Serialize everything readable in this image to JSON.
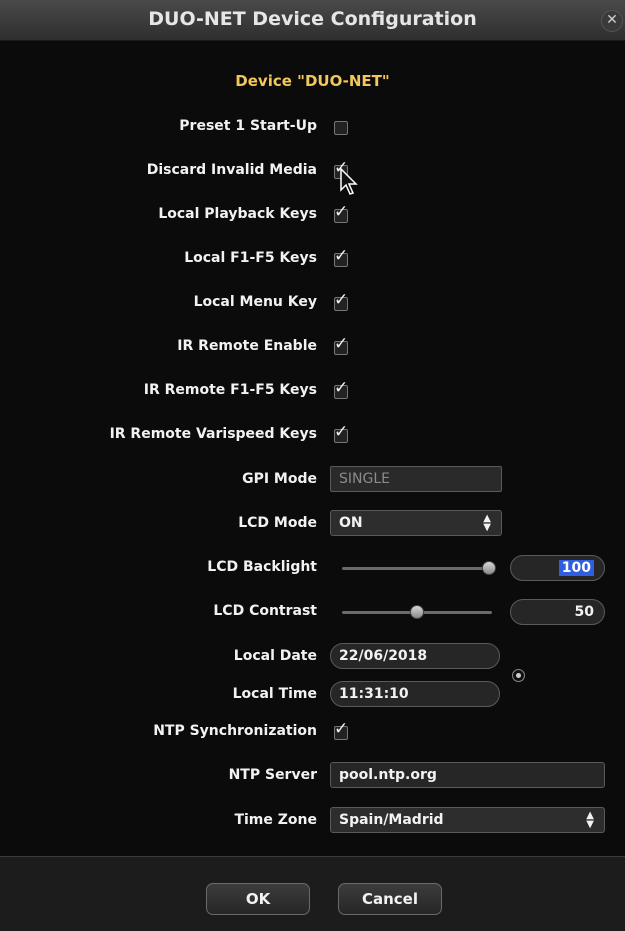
{
  "window": {
    "title": "DUO-NET Device Configuration",
    "close_glyph": "✕"
  },
  "heading": "Device \"DUO-NET\"",
  "checkboxes": [
    {
      "label": "Preset 1 Start-Up",
      "checked": false
    },
    {
      "label": "Discard Invalid Media",
      "checked": true
    },
    {
      "label": "Local Playback Keys",
      "checked": true
    },
    {
      "label": "Local F1-F5 Keys",
      "checked": true
    },
    {
      "label": "Local Menu Key",
      "checked": true
    },
    {
      "label": "IR Remote Enable",
      "checked": true
    },
    {
      "label": "IR Remote F1-F5 Keys",
      "checked": true
    },
    {
      "label": "IR Remote Varispeed Keys",
      "checked": true
    }
  ],
  "check_glyph": "✓",
  "gpi_mode": {
    "label": "GPI Mode",
    "value": "SINGLE"
  },
  "lcd_mode": {
    "label": "LCD Mode",
    "value": "ON",
    "icon": "updown-arrows-icon"
  },
  "lcd_backlight": {
    "label": "LCD Backlight",
    "value": "100"
  },
  "lcd_contrast": {
    "label": "LCD Contrast",
    "value": "50"
  },
  "local_date": {
    "label": "Local Date",
    "value": "22/06/2018"
  },
  "local_time": {
    "label": "Local Time",
    "value": "11:31:10"
  },
  "ntp_sync": {
    "label": "NTP Synchronization",
    "checked": true
  },
  "ntp_server": {
    "label": "NTP Server",
    "value": "pool.ntp.org"
  },
  "time_zone": {
    "label": "Time Zone",
    "value": "Spain/Madrid",
    "icon": "updown-arrows-icon"
  },
  "buttons": {
    "ok": "OK",
    "cancel": "Cancel"
  },
  "colors": {
    "accent": "#f2c75c",
    "selection": "#2f5fe0"
  }
}
